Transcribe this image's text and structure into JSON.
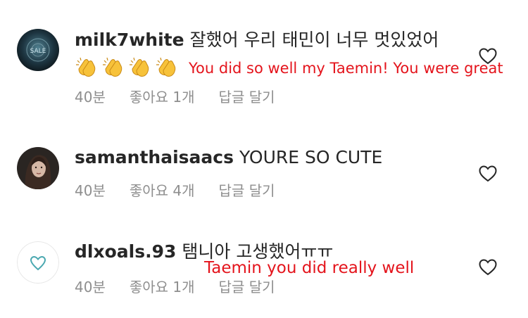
{
  "comments": [
    {
      "username": "milk7white",
      "text": "잘했어 우리 태민이 너무 멋있었어",
      "emojis": [
        "clapping-hands",
        "clapping-hands",
        "clapping-hands",
        "clapping-hands"
      ],
      "translation": "You did so well my Taemin! You were great",
      "time": "40분",
      "likes": "좋아요 1개",
      "reply": "답글 달기",
      "avatar": "avatar-dark-blue"
    },
    {
      "username": "samanthaisaacs",
      "text": "YOURE SO CUTE",
      "time": "40분",
      "likes": "좋아요 4개",
      "reply": "답글 달기",
      "avatar": "avatar-photo-woman"
    },
    {
      "username": "dlxoals.93",
      "text": "탬니아 고생했어ㅠㅠ",
      "translation": "Taemin you did really well",
      "time": "40분",
      "likes": "좋아요 1개",
      "reply": "답글 달기",
      "avatar": "avatar-teal-heart"
    }
  ],
  "colors": {
    "text": "#262626",
    "meta": "#8e8e8e",
    "translation": "#e4141c",
    "heart_stroke": "#262626"
  },
  "icons": {
    "like": "heart-outline-icon"
  }
}
